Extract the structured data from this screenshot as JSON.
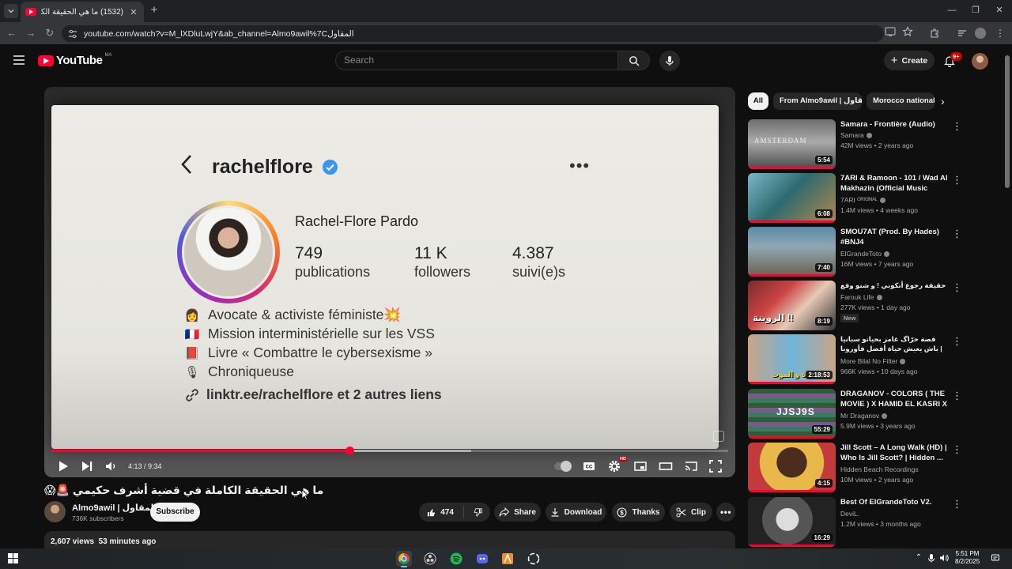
{
  "browser": {
    "tab_title": "(1532) ما هي الحقيقة الكاملة في",
    "url": "youtube.com/watch?v=M_lXDluLwjY&ab_channel=Almo9awil%7Cالمقاول"
  },
  "header": {
    "logo_text": "YouTube",
    "region": "MA",
    "search_placeholder": "Search",
    "create_label": "Create",
    "notification_count": "9+"
  },
  "video": {
    "ig_username": "rachelflore",
    "ig_fullname": "Rachel-Flore Pardo",
    "ig_stats": [
      {
        "num": "749",
        "label": "publications"
      },
      {
        "num": "11 K",
        "label": "followers"
      },
      {
        "num": "4.387",
        "label": "suivi(e)s"
      }
    ],
    "ig_bio": [
      {
        "emoji": "👩",
        "text": "Avocate & activiste féministe💥"
      },
      {
        "emoji": "🇫🇷",
        "text": "Mission interministérielle sur les VSS"
      },
      {
        "emoji": "📕",
        "text": "Livre « Combattre le cybersexisme »"
      },
      {
        "emoji": "🎙",
        "text": "Chroniqueuse"
      }
    ],
    "ig_link": "linktr.ee/rachelflore et 2 autres liens",
    "time_current": "4:13",
    "time_total": "9:34",
    "time_display": "4:13 / 9:34",
    "progress_fraction": 0.441,
    "buffer_fraction": 0.62,
    "hd_badge": "HD"
  },
  "info": {
    "title": "ما هي الحقيقة الكاملة في قضية أشرف حكيمي 🚨😱",
    "channel_name": "Almo9awil | المقاول",
    "subscribers": "736K subscribers",
    "subscribe_label": "Subscribe",
    "like_count": "474",
    "share_label": "Share",
    "download_label": "Download",
    "thanks_label": "Thanks",
    "clip_label": "Clip",
    "views": "2,607 views",
    "posted": "53 minutes ago"
  },
  "sidebar": {
    "chips": [
      "All",
      "From Almo9awil | المقاول",
      "Morocco national"
    ],
    "recommendations": [
      {
        "title": "Samara - Frontière (Audio)",
        "channel": "Samara",
        "meta": "42M views • 2 years ago",
        "duration": "5:54"
      },
      {
        "title": "7ARI & Ramoon - 101 / Wad Al Makhazin (Official Music Video)",
        "channel": "7ARI ᴼᴿᴵᴳᴵᴺᴬᴸ",
        "meta": "1.4M views • 4 weeks ago",
        "duration": "6:08"
      },
      {
        "title": "SMOU7AT (Prod. By Hades) #BNJ4",
        "channel": "ElGrandeToto",
        "meta": "16M views • 7 years ago",
        "duration": "7:40"
      },
      {
        "title": "حقيقة رجوع أنكوني ! و شنو وقع لبوز فلو ؟",
        "channel": "Farouk Life",
        "meta": "277K views • 1 day ago",
        "duration": "8:19",
        "badge": "New"
      },
      {
        "title": "قصة حرّاگ عامر بحياتو سبانيا باش يعيش حياة أفضل فأوروبا | Le Bledard Full ...",
        "channel": "More Bilal No Filter",
        "meta": "966K views • 10 days ago",
        "duration": "2:18:53"
      },
      {
        "title": "DRAGANOV - COLORS ( THE MOVIE ) X HAMID EL KASRI X ...",
        "channel": "Mr Draganov",
        "meta": "5.9M views • 3 years ago",
        "duration": "55:29"
      },
      {
        "title": "Jill Scott – A Long Walk (HD) | Who Is Jill Scott? | Hidden ...",
        "channel": "Hidden Beach Recordings",
        "meta": "10M views • 2 years ago",
        "duration": "4:15"
      },
      {
        "title": "Best Of ElGrandeToto V2.",
        "channel": "DeviL.",
        "meta": "1.2M views • 3 months ago",
        "duration": "16:29"
      }
    ]
  },
  "taskbar": {
    "time": "5:51 PM",
    "date": "8/2/2025"
  },
  "colors": {
    "accent": "#ff0033",
    "background": "#0f0f0f",
    "chip_bg": "#272727"
  }
}
